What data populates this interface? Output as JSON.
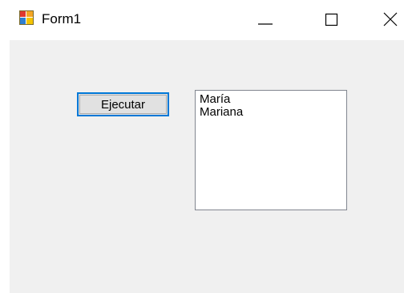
{
  "window": {
    "title": "Form1",
    "icon": "windows-form-icon",
    "controls": {
      "minimize": "minimize-icon",
      "maximize": "maximize-icon",
      "close": "close-icon"
    }
  },
  "form": {
    "execute_button_label": "Ejecutar",
    "listbox_items": [
      "María",
      "Mariana"
    ]
  },
  "colors": {
    "client_background": "#f0f0f0",
    "button_focus_border": "#0078d7",
    "button_background": "#e1e1e1",
    "listbox_border": "#828790"
  }
}
